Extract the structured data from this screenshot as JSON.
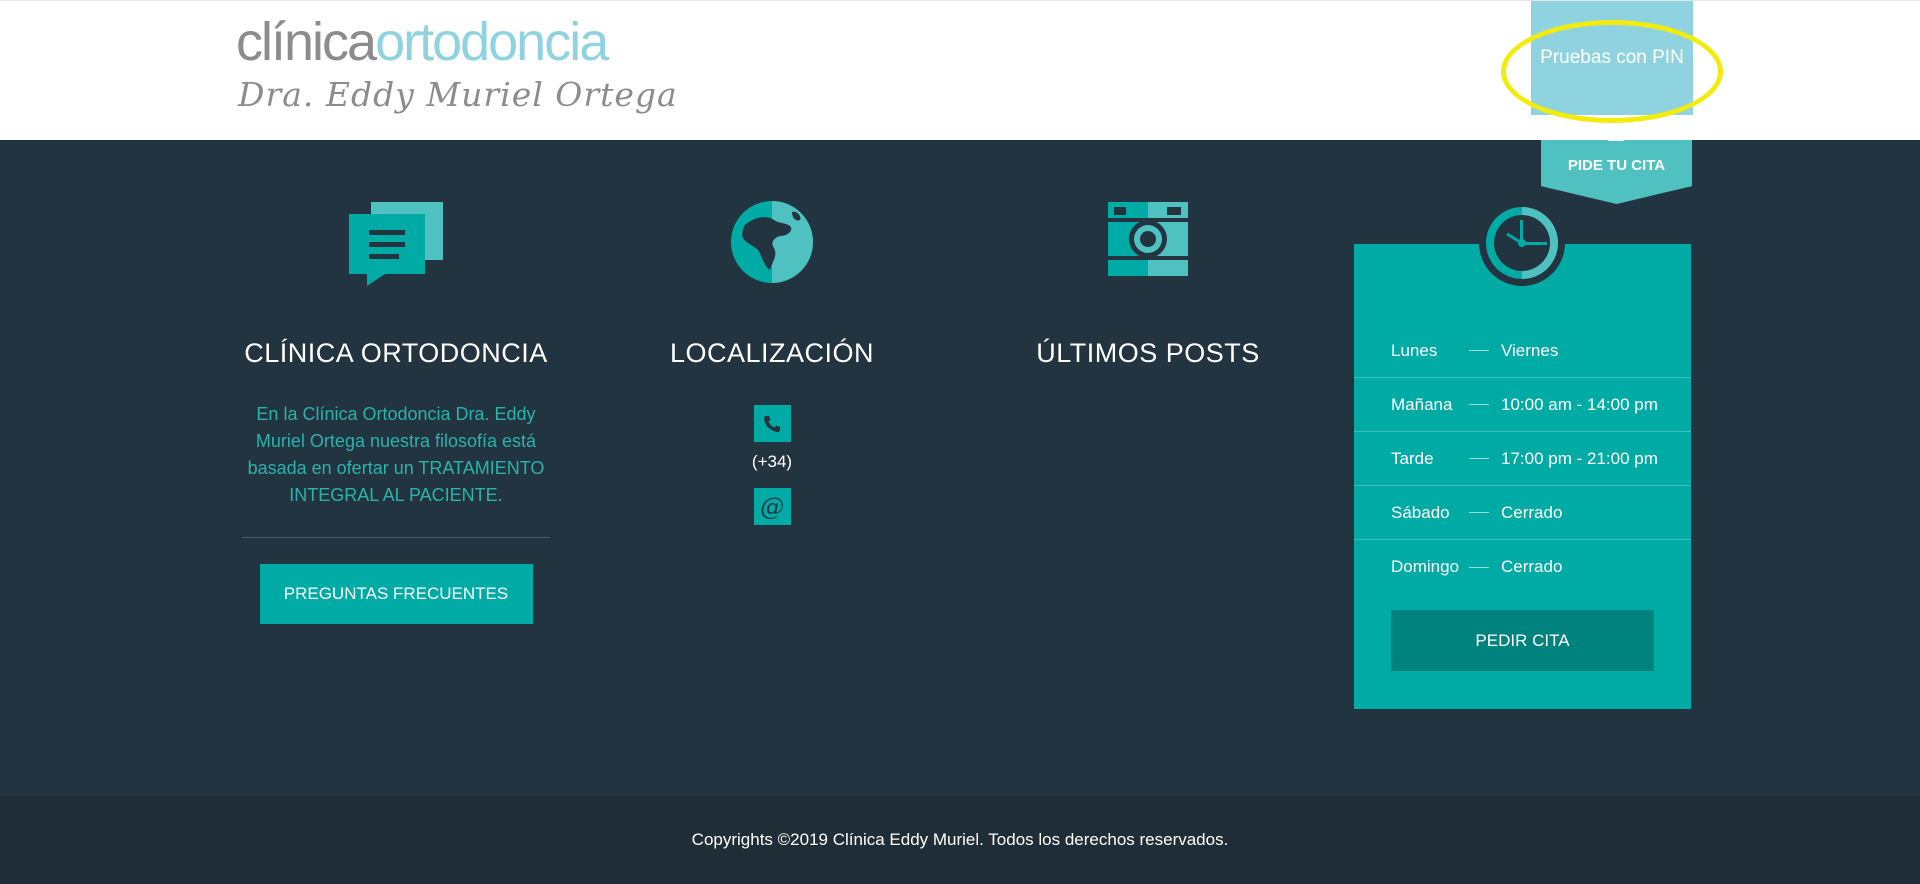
{
  "header": {
    "logo": {
      "top_part1": "clínica",
      "top_part2": "ortodoncia",
      "subtitle": "Dra. Eddy Muriel Ortega"
    },
    "pin_button_label": "Pruebas con PIN"
  },
  "ribbon": {
    "label": "PIDE TU CITA"
  },
  "columns": {
    "clinic": {
      "title": "CLÍNICA ORTODONCIA",
      "description": "En la Clínica Ortodoncia Dra. Eddy Muriel Ortega nuestra filosofía está basada en ofertar un TRATAMIENTO INTEGRAL AL PACIENTE.",
      "faq_button": "PREGUNTAS FRECUENTES"
    },
    "location": {
      "title": "LOCALIZACIÓN",
      "phone": "(+34)",
      "email_glyph": "@"
    },
    "posts": {
      "title": "ÚLTIMOS POSTS"
    }
  },
  "hours": {
    "rows": [
      {
        "day": "Lunes",
        "time": "Viernes"
      },
      {
        "day": "Mañana",
        "time": "10:00 am - 14:00 pm"
      },
      {
        "day": "Tarde",
        "time": "17:00 pm - 21:00 pm"
      },
      {
        "day": "Sábado",
        "time": "Cerrado"
      },
      {
        "day": "Domingo",
        "time": "Cerrado"
      }
    ],
    "button": "PEDIR CITA"
  },
  "footer": {
    "copyright": "Copyrights ©2019 Clínica Eddy Muriel. Todos los derechos reservados."
  },
  "colors": {
    "teal": "#00aaa5",
    "dark_teal": "#00837f",
    "light_blue": "#8fd3e0",
    "background": "#233441",
    "footer": "#1f2d37",
    "highlight_ring": "#f2ec0e"
  },
  "icons": [
    "chat-bubbles-icon",
    "globe-icon",
    "camera-icon",
    "clock-icon",
    "phone-icon",
    "at-icon"
  ]
}
